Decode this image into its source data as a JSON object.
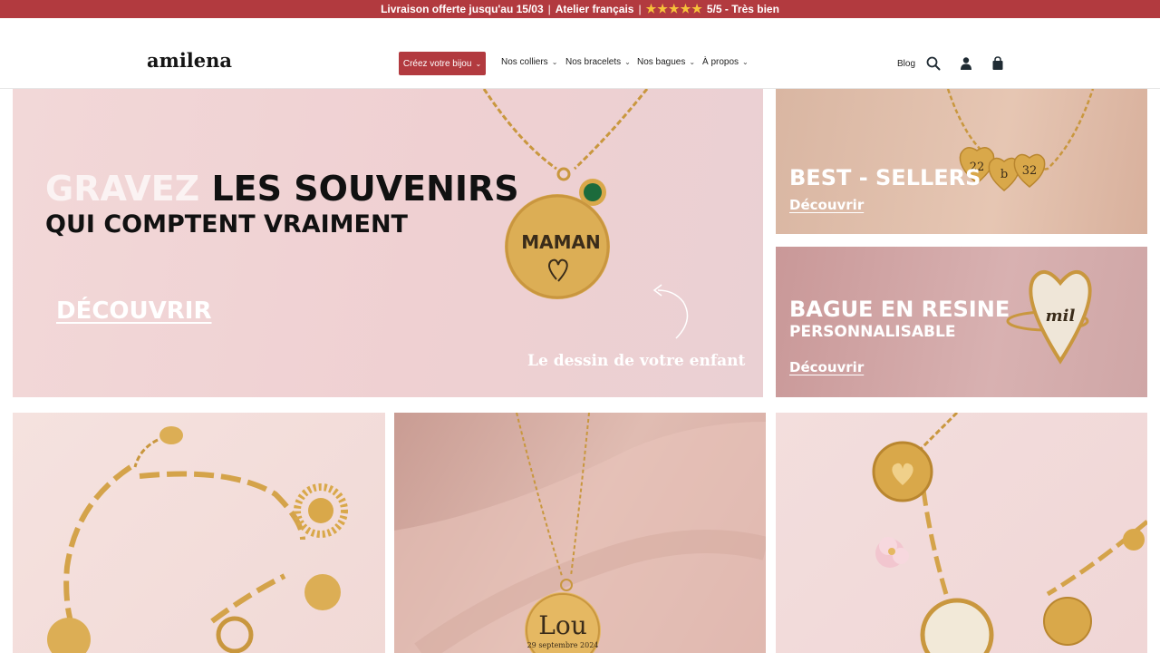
{
  "announcement": {
    "delivery": "Livraison offerte jusqu'au 15/03",
    "separator": "|",
    "atelier": "Atelier français",
    "stars": "★★★★★",
    "rating": "5/5 - Très bien"
  },
  "header": {
    "logo": "amilena",
    "cta_label": "Créez votre bijou",
    "nav": [
      {
        "label": "Nos colliers"
      },
      {
        "label": "Nos bracelets"
      },
      {
        "label": "Nos bagues"
      },
      {
        "label": "À propos"
      }
    ],
    "blog_label": "Blog",
    "icons": [
      "search-icon",
      "account-icon",
      "cart-icon"
    ],
    "chevron": "⌄"
  },
  "hero": {
    "title_light": "GRAVEZ",
    "title_dark": "LES SOUVENIRS",
    "subtitle": "QUI COMPTENT VRAIMENT",
    "cta": "DÉCOUVRIR",
    "pendant_text": "MAMAN",
    "script_text": "Le dessin de votre enfant"
  },
  "side_tiles": [
    {
      "title": "BEST - SELLERS",
      "link": "Découvrir"
    },
    {
      "title": "BAGUE EN RESINE",
      "subtitle": "PERSONNALISABLE",
      "link": "Découvrir",
      "ring_text": "mil"
    }
  ],
  "bottom_tiles": {
    "pendant_name": "Lou",
    "pendant_date": "29 septembre 2024",
    "charm_numbers": [
      "22",
      "b",
      "32"
    ]
  },
  "colors": {
    "brand_red": "#b23a3f",
    "gold": "#d9a84a",
    "star": "#f6c23a"
  }
}
